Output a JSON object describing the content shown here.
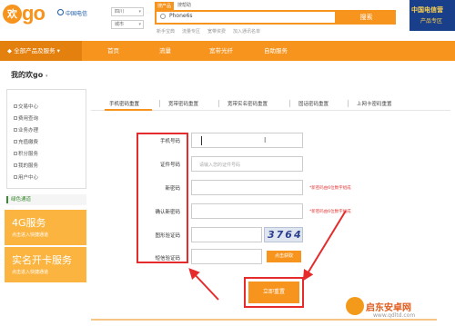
{
  "header": {
    "logo_char": "欢",
    "logo_text": "go",
    "telecom_name": "中国电信",
    "province_select": "四川",
    "city_select": "城市",
    "search_tabs": [
      "搜产品",
      "搜帮助"
    ],
    "search_value": "Phone6s",
    "search_button": "搜索",
    "hot_words": [
      "新手宝典",
      "流量专区",
      "宽带资费",
      "加入通讯名单"
    ],
    "ad_line1": "中国电信营",
    "ad_line2": "产品专区"
  },
  "nav": {
    "all_products": "全部产品及服务",
    "items": [
      "首页",
      "流量",
      "宽带光纤",
      "自助服务"
    ]
  },
  "page_title": "我的欢go",
  "sidebar": {
    "items": [
      "交易中心",
      "费用查询",
      "业务办理",
      "充值缴费",
      "积分服务",
      "我的服务",
      "用户中心"
    ],
    "green_channel": "绿色通道",
    "promos": [
      {
        "title": "4G服务",
        "sub": "点击进入快捷通道"
      },
      {
        "title": "实名开卡服务",
        "sub": "点击进入快捷通道"
      }
    ]
  },
  "tabs": [
    "手机密码重置",
    "宽带密码重置",
    "宽带实名密码重置",
    "固话密码重置",
    "上网卡密码重置"
  ],
  "form": {
    "labels": [
      "手机号码",
      "证件号码",
      "新密码",
      "确认新密码",
      "图形验证码",
      "短信验证码"
    ],
    "id_placeholder": "请输入您的证件号码",
    "hint": "*新密码由6位数字组成",
    "captcha": "3764",
    "sms_button": "点击获取",
    "submit_button": "立即重置"
  },
  "watermark": {
    "line1": "启东安卓网",
    "line2": "www.qdltd.com"
  },
  "colors": {
    "brand": "#f7941d",
    "alert": "#e52b2b"
  }
}
